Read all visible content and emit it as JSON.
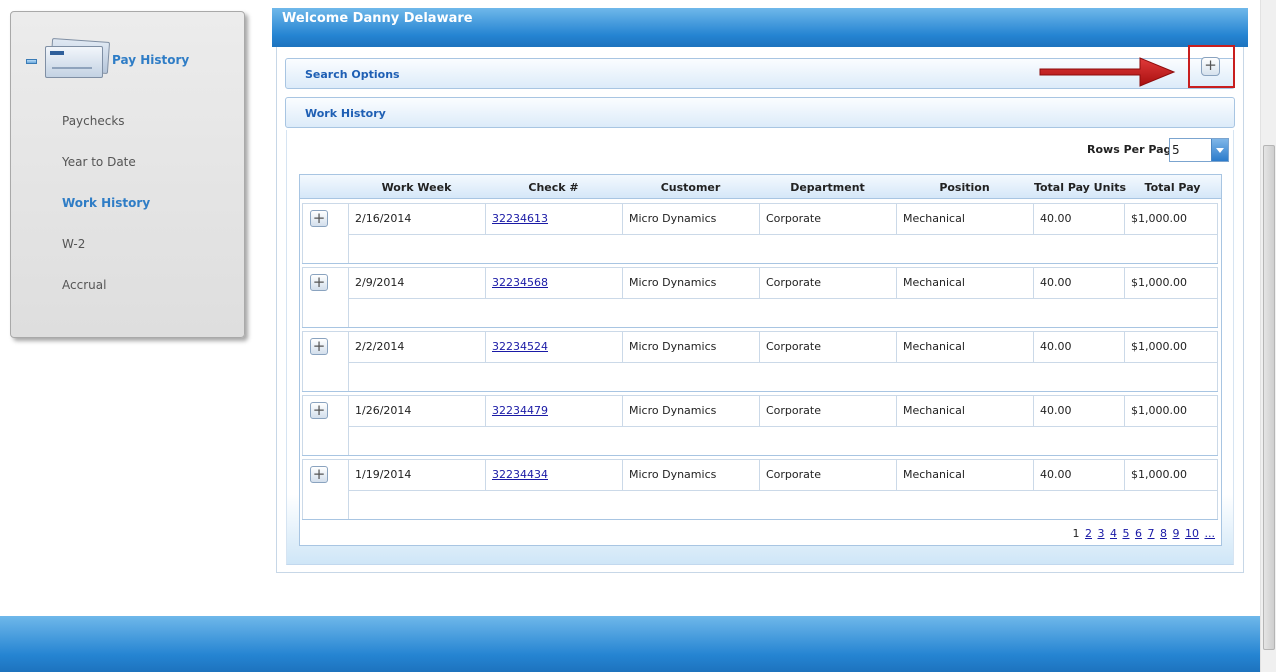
{
  "sidebar": {
    "title": "Pay History",
    "items": [
      {
        "label": "Paychecks",
        "active": false
      },
      {
        "label": "Year to Date",
        "active": false
      },
      {
        "label": "Work History",
        "active": true
      },
      {
        "label": "W-2",
        "active": false
      },
      {
        "label": "Accrual",
        "active": false
      }
    ]
  },
  "header": {
    "welcome": "Welcome Danny Delaware"
  },
  "panels": {
    "search_options": "Search Options",
    "work_history": "Work History"
  },
  "toolbar": {
    "expand_symbol": "+"
  },
  "grid": {
    "rows_per_page_label": "Rows Per Page",
    "rows_per_page_value": "5",
    "columns": [
      "Work Week",
      "Check #",
      "Customer",
      "Department",
      "Position",
      "Total Pay Units",
      "Total Pay"
    ],
    "rows": [
      {
        "week": "2/16/2014",
        "check": "32234613",
        "customer": "Micro Dynamics",
        "department": "Corporate",
        "position": "Mechanical",
        "units": "40.00",
        "pay": "$1,000.00"
      },
      {
        "week": "2/9/2014",
        "check": "32234568",
        "customer": "Micro Dynamics",
        "department": "Corporate",
        "position": "Mechanical",
        "units": "40.00",
        "pay": "$1,000.00"
      },
      {
        "week": "2/2/2014",
        "check": "32234524",
        "customer": "Micro Dynamics",
        "department": "Corporate",
        "position": "Mechanical",
        "units": "40.00",
        "pay": "$1,000.00"
      },
      {
        "week": "1/26/2014",
        "check": "32234479",
        "customer": "Micro Dynamics",
        "department": "Corporate",
        "position": "Mechanical",
        "units": "40.00",
        "pay": "$1,000.00"
      },
      {
        "week": "1/19/2014",
        "check": "32234434",
        "customer": "Micro Dynamics",
        "department": "Corporate",
        "position": "Mechanical",
        "units": "40.00",
        "pay": "$1,000.00"
      }
    ],
    "pager": {
      "current": "1",
      "pages": [
        "2",
        "3",
        "4",
        "5",
        "6",
        "7",
        "8",
        "9",
        "10",
        "..."
      ]
    }
  },
  "colors": {
    "accent": "#2584d2",
    "link": "#1a1aa6",
    "highlight": "#c81e1e"
  },
  "icons": {
    "collapse": "collapse-icon",
    "paycheck": "paycheck-icon",
    "expand": "plus-icon",
    "arrow": "red-arrow-icon",
    "dropdown": "chevron-down-icon"
  }
}
